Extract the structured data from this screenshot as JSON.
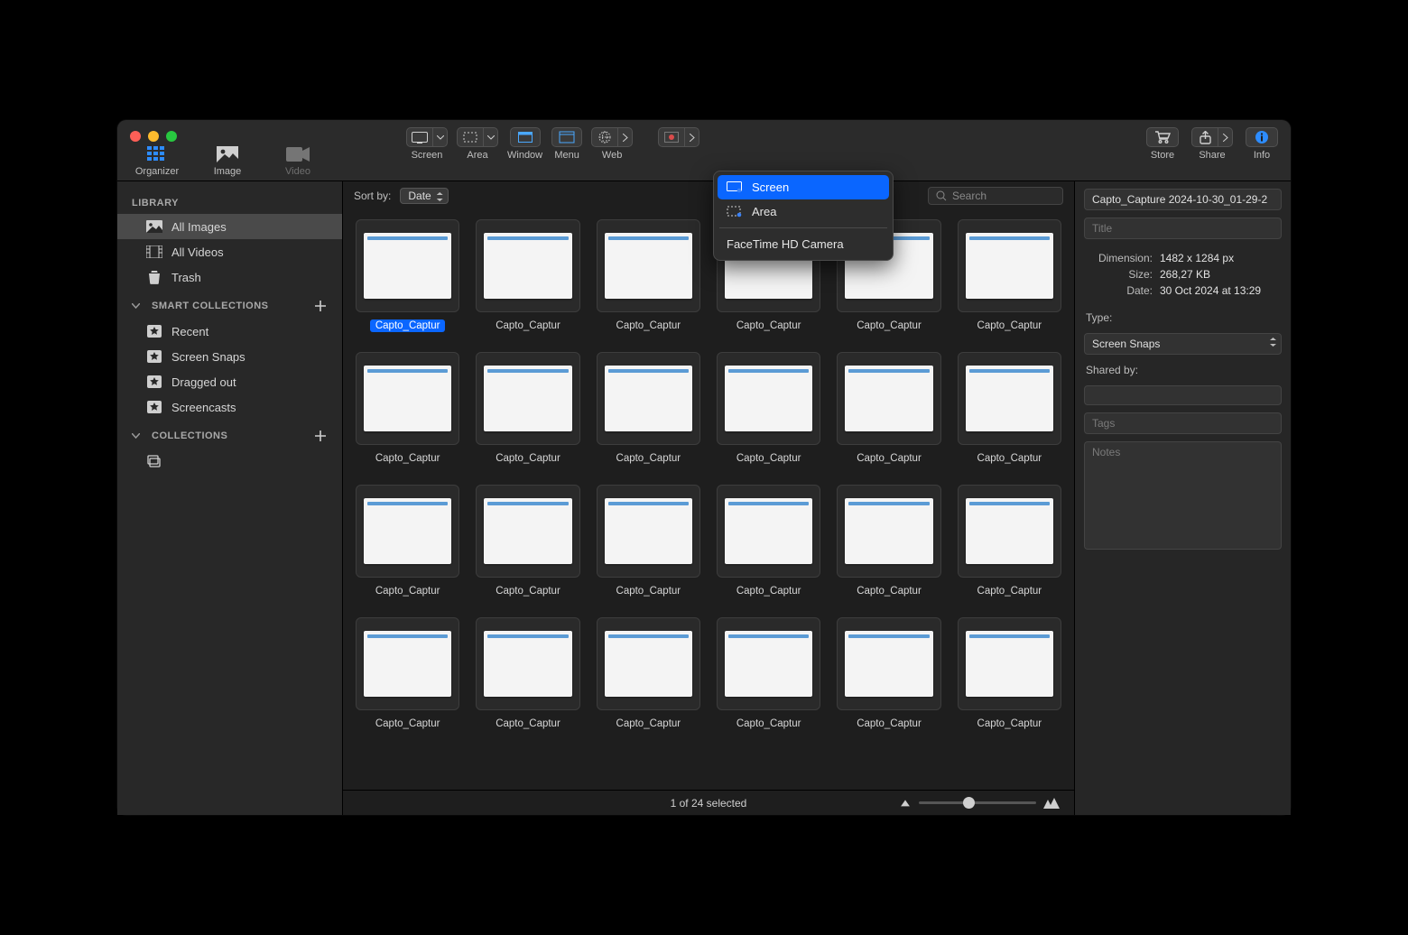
{
  "modes": {
    "organizer": "Organizer",
    "image": "Image",
    "video": "Video"
  },
  "toolbar": {
    "screen": "Screen",
    "area": "Area",
    "window": "Window",
    "menu": "Menu",
    "web": "Web",
    "store": "Store",
    "share": "Share",
    "info": "Info"
  },
  "sidebar": {
    "library": "LIBRARY",
    "library_items": [
      "All Images",
      "All Videos",
      "Trash"
    ],
    "smart": "SMART COLLECTIONS",
    "smart_items": [
      "Recent",
      "Screen Snaps",
      "Dragged out",
      "Screencasts"
    ],
    "collections": "COLLECTIONS"
  },
  "sort": {
    "label": "Sort by:",
    "value": "Date"
  },
  "search_placeholder": "Search",
  "grid_labels": [
    "Capto_Captur",
    "Capto_Captur",
    "Capto_Captur",
    "Capto_Captur",
    "Capto_Captur",
    "Capto_Captur",
    "Capto_Captur",
    "Capto_Captur",
    "Capto_Captur",
    "Capto_Captur",
    "Capto_Captur",
    "Capto_Captur",
    "Capto_Captur",
    "Capto_Captur",
    "Capto_Captur",
    "Capto_Captur",
    "Capto_Captur",
    "Capto_Captur",
    "Capto_Captur",
    "Capto_Captur",
    "Capto_Captur",
    "Capto_Captur",
    "Capto_Captur",
    "Capto_Captur"
  ],
  "status": "1 of 24 selected",
  "info": {
    "filename": "Capto_Capture 2024-10-30_01-29-2",
    "title_placeholder": "Title",
    "dimension_k": "Dimension:",
    "dimension_v": "1482 x 1284 px",
    "size_k": "Size:",
    "size_v": "268,27 KB",
    "date_k": "Date:",
    "date_v": "30 Oct 2024 at 13:29",
    "type_k": "Type:",
    "type_v": "Screen Snaps",
    "shared_k": "Shared by:",
    "tags_placeholder": "Tags",
    "notes_placeholder": "Notes"
  },
  "popup": {
    "screen": "Screen",
    "area": "Area",
    "camera": "FaceTime HD Camera"
  }
}
